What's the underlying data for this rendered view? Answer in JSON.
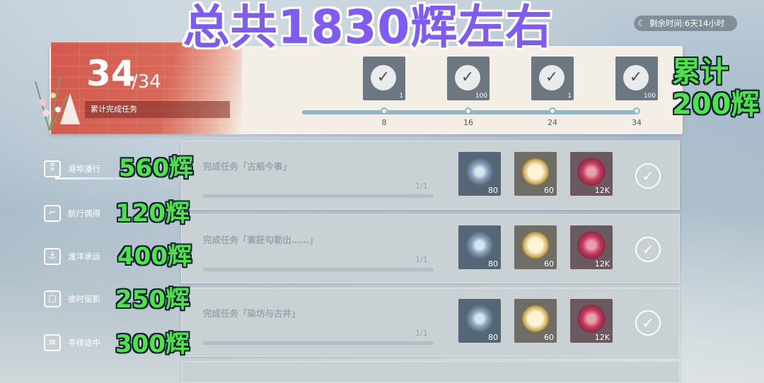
{
  "overlay": {
    "title": "总共1830辉左右",
    "cumulative_line1": "累计",
    "cumulative_line2": "200辉",
    "side_rewards": [
      "560辉",
      "120辉",
      "400辉",
      "250辉",
      "300辉"
    ]
  },
  "timer": {
    "icon": "moon-icon",
    "text": "剩余时间:6天14小时"
  },
  "summary": {
    "completed": "34",
    "total": "/34",
    "label": "累计完成任务"
  },
  "milestones": [
    {
      "threshold": "8",
      "qty": "1",
      "claimed": true
    },
    {
      "threshold": "16",
      "qty": "100",
      "claimed": true
    },
    {
      "threshold": "24",
      "qty": "1",
      "claimed": true
    },
    {
      "threshold": "34",
      "qty": "100",
      "claimed": true
    }
  ],
  "progress": {
    "fraction": 1.0
  },
  "sidebar": {
    "items": [
      {
        "label": "港埠漫行",
        "icon": "footprints-icon",
        "active": true
      },
      {
        "label": "航行偶得",
        "icon": "boot-icon",
        "active": false
      },
      {
        "label": "渡洋承运",
        "icon": "anchor-icon",
        "active": false
      },
      {
        "label": "彼时留影",
        "icon": "photo-frame-icon",
        "active": false
      },
      {
        "label": "寻绎途中",
        "icon": "road-icon",
        "active": false
      }
    ]
  },
  "tasks": [
    {
      "title": "完成任务「古船今事」",
      "progress": "1/1",
      "rewards": [
        "80",
        "60",
        "12K"
      ]
    },
    {
      "title": "完成任务「素胚勾勒出……」",
      "progress": "1/1",
      "rewards": [
        "80",
        "60",
        "12K"
      ]
    },
    {
      "title": "完成任务「染坊与古井」",
      "progress": "1/1",
      "rewards": [
        "80",
        "60",
        "12K"
      ]
    }
  ],
  "colors": {
    "accent_red": "#d2594d",
    "overlay_purple": "#7e5cf2",
    "overlay_green": "#4fe34a"
  }
}
